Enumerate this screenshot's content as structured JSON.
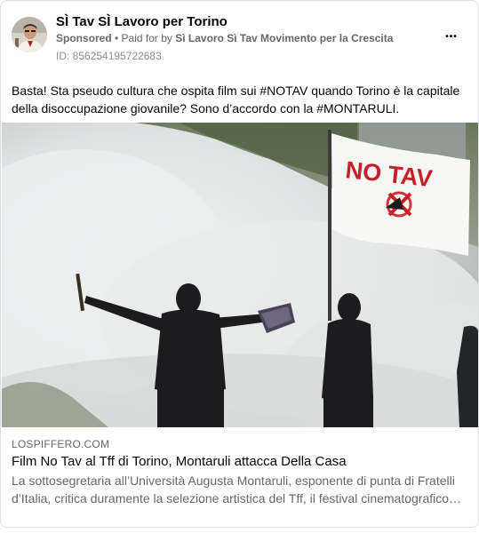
{
  "post": {
    "page_name": "SÌ Tav SÌ Lavoro per Torino",
    "sponsored_label": "Sponsored",
    "separator": " • ",
    "paid_for_prefix": "Paid for by ",
    "payer": "Sì Lavoro Sì Tav Movimento per la Crescita",
    "ad_id": "ID: 856254195722683",
    "more_label": "•••",
    "text": "Basta! Sta pseudo cultura che ospita film sui #NOTAV quando Torino è la capitale della disoccupazione giovanile? Sono d’accordo con la #MONTARULI."
  },
  "photo": {
    "flag_text": "NO TAV"
  },
  "link": {
    "domain": "LOSPIFFERO.COM",
    "headline": "Film No Tav al Tff di Torino, Montaruli attacca Della Casa",
    "description": "La sottosegretaria all’Università Augusta Montaruli, esponente di punta di Fratelli d’Italia, critica duramente la selezione artistica del Tff, il festival cinematografico…"
  },
  "colors": {
    "card_border": "#dddfe2",
    "secondary_text": "#65676b",
    "primary_text": "#050505",
    "flag_red": "#c8202a"
  }
}
